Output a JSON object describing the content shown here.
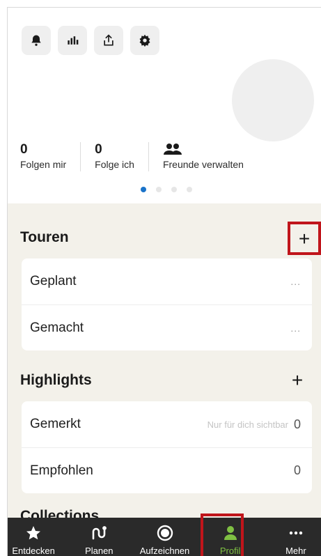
{
  "toolbar": {
    "icons": [
      "bell-icon",
      "stats-icon",
      "share-icon",
      "gear-icon"
    ]
  },
  "stats": {
    "followers": {
      "count": "0",
      "label": "Folgen mir"
    },
    "following": {
      "count": "0",
      "label": "Folge ich"
    },
    "friends": {
      "label": "Freunde verwalten"
    }
  },
  "pager": {
    "total": 4,
    "active": 1
  },
  "tours": {
    "title": "Touren",
    "add": "+",
    "items": [
      {
        "label": "Geplant",
        "more": "..."
      },
      {
        "label": "Gemacht",
        "more": "..."
      }
    ]
  },
  "highlights": {
    "title": "Highlights",
    "add": "+",
    "items": [
      {
        "label": "Gemerkt",
        "hint": "Nur für dich sichtbar",
        "count": "0"
      },
      {
        "label": "Empfohlen",
        "count": "0"
      }
    ]
  },
  "collections": {
    "title": "Collections"
  },
  "nav": {
    "items": [
      {
        "label": "Entdecken",
        "icon": "star-icon"
      },
      {
        "label": "Planen",
        "icon": "route-icon"
      },
      {
        "label": "Aufzeichnen",
        "icon": "record-icon"
      },
      {
        "label": "Profil",
        "icon": "person-icon",
        "active": true
      },
      {
        "label": "Mehr",
        "icon": "more-icon"
      }
    ]
  },
  "colors": {
    "accent": "#7fc043",
    "active_dot": "#1a73c9",
    "highlight_box": "#c0151b",
    "nav_bg": "#2a2a2a",
    "section_bg": "#f3f1ea"
  }
}
